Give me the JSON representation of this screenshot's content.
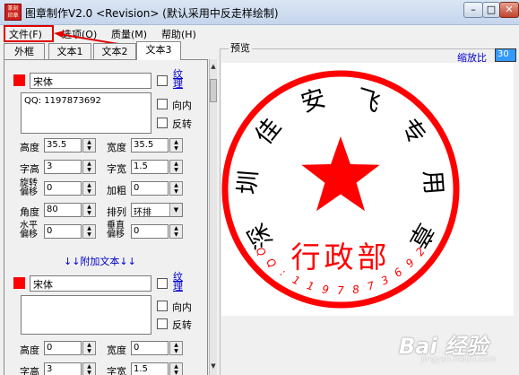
{
  "titlebar": {
    "icon_text": "篆刻印章",
    "title": "图章制作V2.0 <Revision> (默认采用中反走样绘制)",
    "minimize": "–",
    "maximize": "□",
    "close": "✕"
  },
  "menu": {
    "file": "文件(F)",
    "options": "选项(O)",
    "quality": "质量(M)",
    "help": "帮助(H)"
  },
  "tabs": [
    "外框",
    "文本1",
    "文本2",
    "文本3"
  ],
  "text_block_1": {
    "font": "宋体",
    "grain_label": "纹理",
    "content": "QQ: 1197873692",
    "inward_label": "向内",
    "reverse_label": "反转",
    "height_label": "高度",
    "height_value": "35.5",
    "width_label": "宽度",
    "width_value": "35.5",
    "char_height_label": "字高",
    "char_height_value": "3",
    "char_width_label": "字宽",
    "char_width_value": "1.5",
    "rotation_offset_label": "旋转偏移",
    "rotation_offset_value": "0",
    "bold_label": "加粗",
    "bold_value": "0",
    "angle_label": "角度",
    "angle_value": "80",
    "arrange_label": "排列",
    "arrange_value": "环排",
    "h_offset_label": "水平偏移",
    "h_offset_value": "0",
    "v_offset_label": "垂直偏移",
    "v_offset_value": "0"
  },
  "add_text_label": "↓↓附加文本↓↓",
  "text_block_2": {
    "font": "宋体",
    "grain_label": "纹理",
    "content": "",
    "inward_label": "向内",
    "reverse_label": "反转",
    "height_label": "高度",
    "height_value": "0",
    "width_label": "宽度",
    "width_value": "0",
    "char_height_label": "字高",
    "char_height_value": "3",
    "char_width_label": "字宽",
    "char_width_value": "1.5"
  },
  "preview": {
    "label": "预览",
    "zoom_label": "缩放比",
    "zoom_value": "30"
  },
  "seal": {
    "ring_chars": [
      "深",
      "圳",
      "佳",
      "安",
      "飞",
      "专",
      "用",
      "章"
    ],
    "center_text": "行政部",
    "bottom_text": "QQ:1197873692",
    "color": "#ff0000"
  },
  "watermark": {
    "text": "Bai 经验",
    "sub": "jingyan.baidu.com"
  },
  "colors": {
    "seal_red": "#ff0000",
    "annotation_red": "#e00000",
    "link_blue": "#0000cc"
  }
}
